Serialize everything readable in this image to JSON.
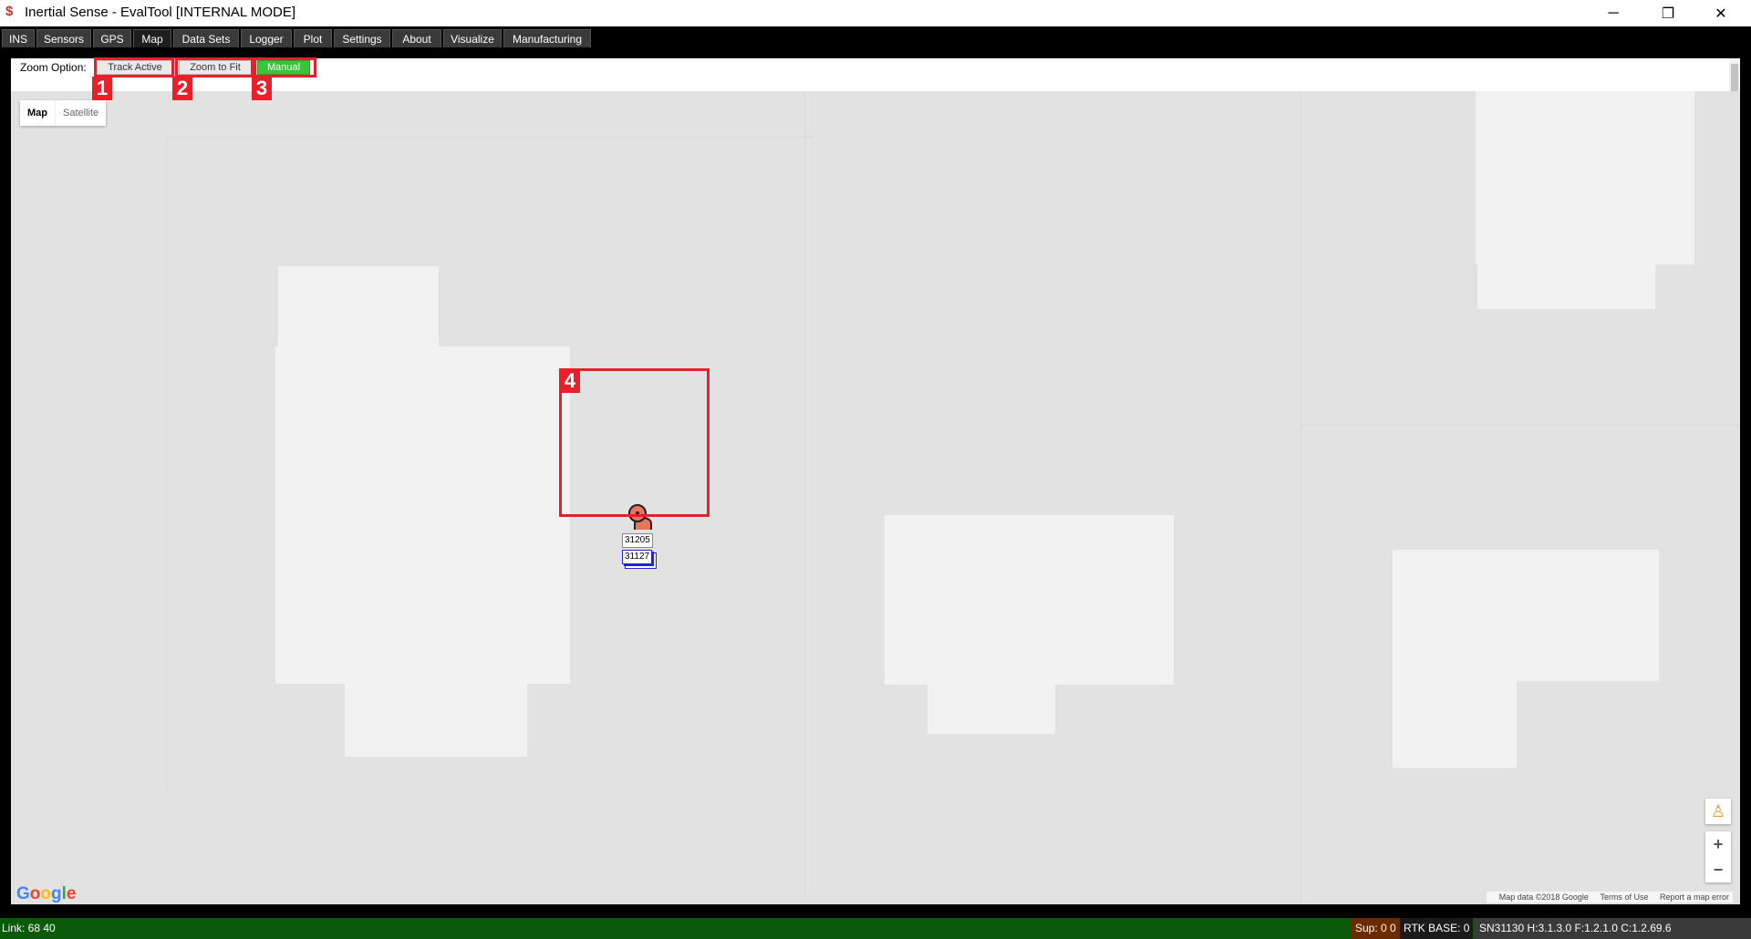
{
  "window": {
    "title": "Inertial Sense - EvalTool [INTERNAL MODE]",
    "minimize": "─",
    "maximize": "❐",
    "close": "✕"
  },
  "tabs": [
    {
      "label": "INS"
    },
    {
      "label": "Sensors"
    },
    {
      "label": "GPS"
    },
    {
      "label": "Map"
    },
    {
      "label": "Data Sets"
    },
    {
      "label": "Logger"
    },
    {
      "label": "Plot"
    },
    {
      "label": "Settings"
    },
    {
      "label": "About"
    },
    {
      "label": "Visualize"
    },
    {
      "label": "Manufacturing"
    }
  ],
  "active_tab": "Map",
  "zoom": {
    "label": "Zoom Option:",
    "track_active": "Track Active",
    "zoom_to_fit": "Zoom to Fit",
    "manual": "Manual",
    "selected": "Manual"
  },
  "map": {
    "type_map": "Map",
    "type_satellite": "Satellite",
    "zoom_in": "+",
    "zoom_out": "−",
    "logo": "Google",
    "attribution": {
      "data": "Map data ©2018 Google",
      "terms": "Terms of Use",
      "report": "Report a map error"
    },
    "markers": [
      {
        "label": "31205"
      },
      {
        "label": "31127"
      }
    ]
  },
  "callouts": [
    "1",
    "2",
    "3",
    "4"
  ],
  "status": {
    "link": "Link: 68 40",
    "sup": "Sup: 0 0",
    "rtk": "RTK BASE: 0",
    "serial": "SN31130 H:3.1.3.0  F:1.2.1.0  C:1.2.69.6"
  },
  "colors": {
    "accent_red": "#e8202a",
    "active_green": "#39c43a",
    "status_green": "#0a5a0a"
  }
}
